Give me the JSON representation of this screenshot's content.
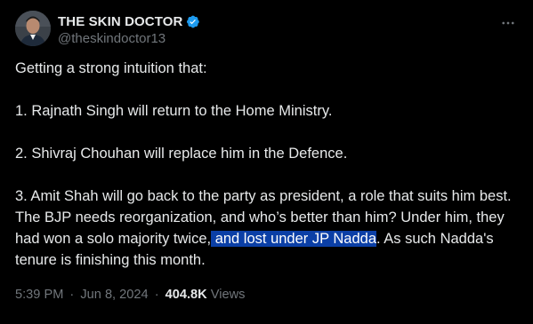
{
  "author": {
    "display_name": "THE SKIN DOCTOR",
    "handle": "@theskindoctor13",
    "verified_color": "#1d9bf0"
  },
  "icons": {
    "avatar": "avatar-photo",
    "verified": "verified-badge-icon",
    "more": "more-horizontal-icon"
  },
  "tweet": {
    "line_intro": "Getting a strong intuition that:",
    "point1": "1. Rajnath Singh will return to the Home Ministry.",
    "point2": "2. Shivraj Chouhan will replace him in the Defence.",
    "point3_before": "3. Amit Shah will go back to the party as president, a role that suits him best. The BJP needs reorganization, and who’s better than him? Under him, they had won a solo majority twice,",
    "point3_highlight": " and lost under JP Nadda",
    "point3_after": ". As such Nadda's tenure is finishing this month.",
    "highlight_color": "#0b3fa6"
  },
  "meta": {
    "time": "5:39 PM",
    "dot1": "·",
    "date": "Jun 8, 2024",
    "dot2": "·",
    "views_count": "404.8K",
    "views_label": "Views"
  }
}
